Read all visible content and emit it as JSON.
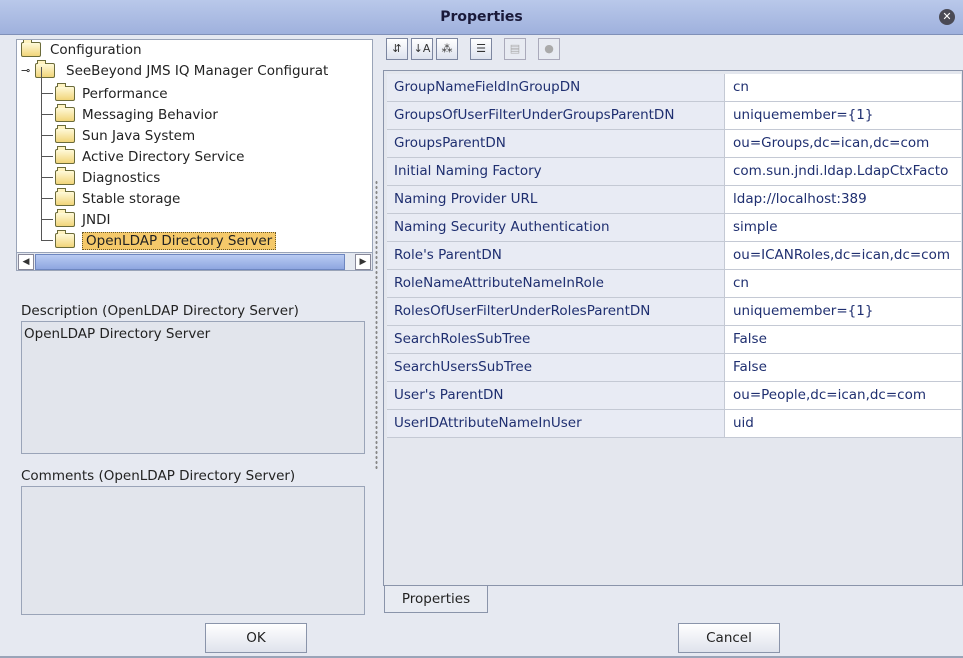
{
  "window": {
    "title": "Properties"
  },
  "tree": {
    "root": "Configuration",
    "child": "SeeBeyond JMS IQ Manager Configurat",
    "items": [
      "Performance",
      "Messaging Behavior",
      "Sun Java System",
      "Active Directory Service",
      "Diagnostics",
      "Stable storage",
      "JNDI",
      "OpenLDAP Directory Server"
    ],
    "selected": "OpenLDAP Directory Server"
  },
  "description": {
    "label": "Description (OpenLDAP Directory Server)",
    "text": "OpenLDAP Directory Server"
  },
  "comments": {
    "label": "Comments (OpenLDAP Directory Server)",
    "text": ""
  },
  "toolbar": {
    "icons": [
      "sort-unsorted-icon",
      "sort-alpha-icon",
      "sort-category-icon",
      "properties-list-icon",
      "disabled-box-icon",
      "help-icon"
    ]
  },
  "properties": [
    {
      "name": "GroupNameFieldInGroupDN",
      "value": "cn"
    },
    {
      "name": "GroupsOfUserFilterUnderGroupsParentDN",
      "value": "uniquemember={1}"
    },
    {
      "name": "GroupsParentDN",
      "value": "ou=Groups,dc=ican,dc=com"
    },
    {
      "name": "Initial Naming Factory",
      "value": "com.sun.jndi.ldap.LdapCtxFacto"
    },
    {
      "name": "Naming Provider URL",
      "value": "ldap://localhost:389"
    },
    {
      "name": "Naming Security Authentication",
      "value": "simple"
    },
    {
      "name": "Role's ParentDN",
      "value": "ou=ICANRoles,dc=ican,dc=com"
    },
    {
      "name": "RoleNameAttributeNameInRole",
      "value": "cn"
    },
    {
      "name": "RolesOfUserFilterUnderRolesParentDN",
      "value": "uniquemember={1}"
    },
    {
      "name": "SearchRolesSubTree",
      "value": "False"
    },
    {
      "name": "SearchUsersSubTree",
      "value": "False"
    },
    {
      "name": "User's ParentDN",
      "value": "ou=People,dc=ican,dc=com"
    },
    {
      "name": "UserIDAttributeNameInUser",
      "value": "uid"
    }
  ],
  "tab": {
    "label": "Properties"
  },
  "buttons": {
    "ok": "OK",
    "cancel": "Cancel"
  }
}
